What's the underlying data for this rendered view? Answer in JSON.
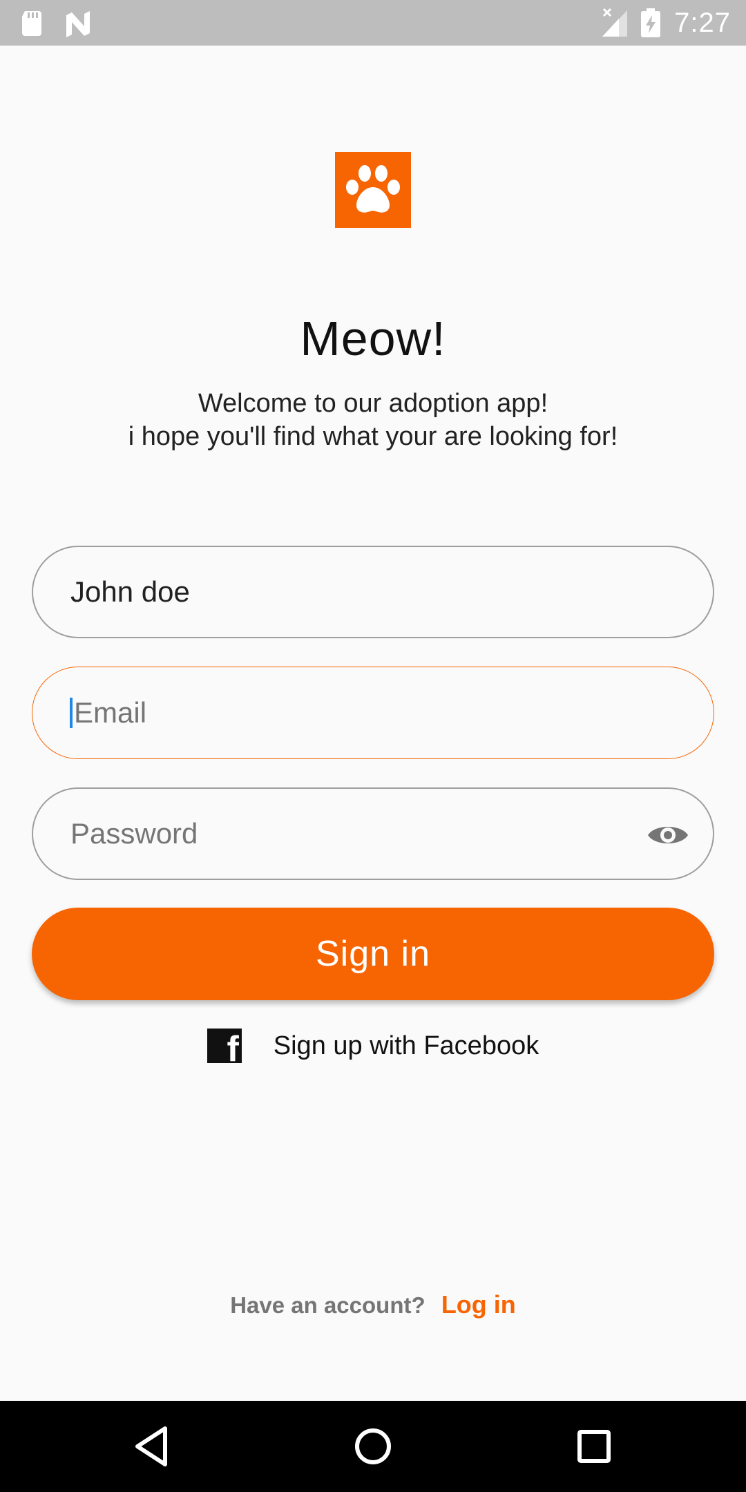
{
  "status_bar": {
    "time": "7:27",
    "icons": [
      "sd-card-icon",
      "n-notification-icon",
      "no-signal-icon",
      "battery-charging-icon"
    ]
  },
  "brand": {
    "logo_icon": "paw-icon",
    "title": "Meow!",
    "subtitle_line1": "Welcome to our adoption app!",
    "subtitle_line2": "i hope you'll find what your are looking for!"
  },
  "form": {
    "name_value": "John doe",
    "email_placeholder": "Email",
    "password_placeholder": "Password",
    "password_toggle_icon": "eye-icon",
    "signin_label": "Sign in",
    "facebook_label": "Sign up with Facebook",
    "facebook_icon": "facebook-icon"
  },
  "footer": {
    "text": "Have an account?",
    "login_label": "Log in"
  },
  "nav_bar": {
    "buttons": [
      "back-icon",
      "home-icon",
      "recents-icon"
    ]
  },
  "colors": {
    "accent": "#f76503",
    "focused_border": "#f76503",
    "field_border": "#9e9e9e",
    "caret": "#1e88e5"
  }
}
